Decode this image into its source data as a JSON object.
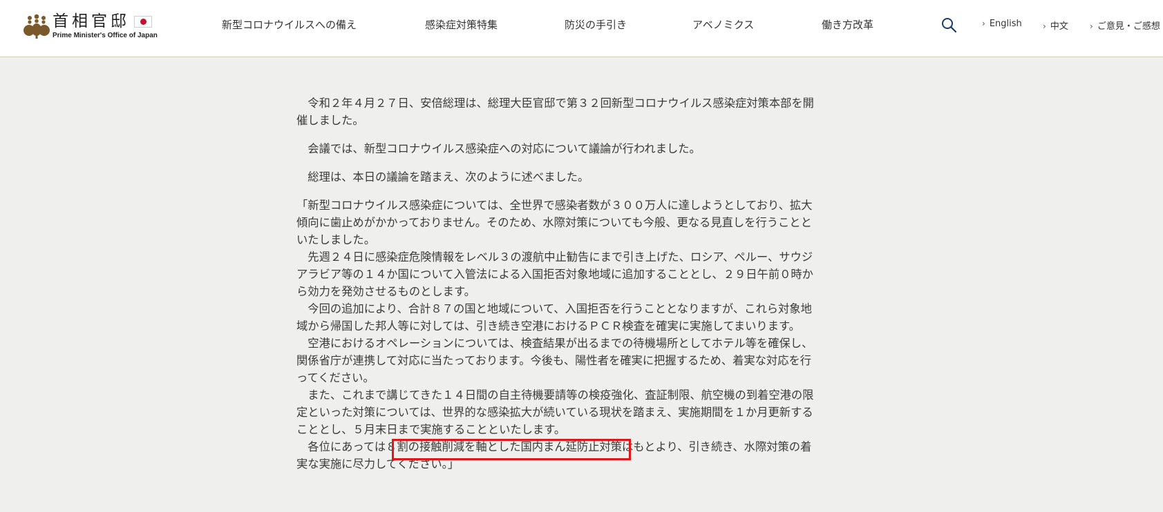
{
  "header": {
    "logo_title": "首相官邸",
    "logo_subtitle": "Prime Minister's Office of Japan",
    "nav_items": [
      {
        "label": "新型コロナウイルスへの備え"
      },
      {
        "label": "感染症対策特集"
      },
      {
        "label": "防災の手引き"
      },
      {
        "label": "アベノミクス"
      },
      {
        "label": "働き方改革"
      }
    ],
    "search_icon": "search-icon",
    "utility_links": [
      {
        "label": "English"
      },
      {
        "label": "中文"
      },
      {
        "label": "ご意見・ご感想"
      }
    ]
  },
  "article": {
    "paragraphs": [
      "　令和２年４月２７日、安倍総理は、総理大臣官邸で第３２回新型コロナウイルス感染症対策本部を開催しました。",
      "　会議では、新型コロナウイルス感染症への対応について議論が行われました。",
      "　総理は、本日の議論を踏まえ、次のように述べました。"
    ],
    "quote_lines": [
      "「新型コロナウイルス感染症については、全世界で感染者数が３００万人に達しようとしており、拡大傾向に歯止めがかかっておりません。そのため、水際対策についても今般、更なる見直しを行うことといたしました。",
      "　先週２４日に感染症危険情報をレベル３の渡航中止勧告にまで引き上げた、ロシア、ペルー、サウジアラビア等の１４か国について入管法による入国拒否対象地域に追加することとし、２９日午前０時から効力を発効させるものとします。",
      "　今回の追加により、合計８７の国と地域について、入国拒否を行うこととなりますが、これら対象地域から帰国した邦人等に対しては、引き続き空港におけるＰＣＲ検査を確実に実施してまいります。",
      "　空港におけるオペレーションについては、検査結果が出るまでの待機場所としてホテル等を確保し、関係省庁が連携して対応に当たっております。今後も、陽性者を確実に把握するため、着実な対応を行ってください。",
      "　また、これまで講じてきた１４日間の自主待機要請等の検疫強化、査証制限、航空機の到着空港の限定といった対策については、世界的な感染拡大が続いている現状を踏まえ、実施期間を１か月更新することとし、５月末日まで実施することといたします。",
      "　各位にあっては８割の接触削減を軸とした国内まん延防止対策はもとより、引き続き、水際対策の着実な実施に尽力してください。」"
    ]
  },
  "colors": {
    "page_background": "#efefed",
    "header_background": "#ffffff",
    "highlight_border": "#e0161b"
  }
}
